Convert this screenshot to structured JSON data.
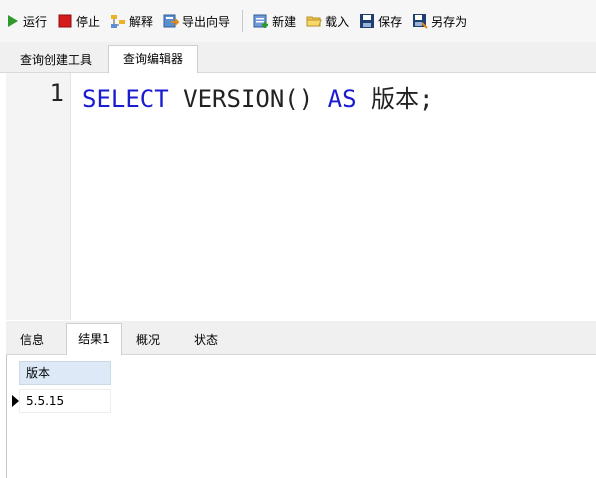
{
  "toolbar": {
    "run": "运行",
    "stop": "停止",
    "explain": "解释",
    "export_wizard": "导出向导",
    "new": "新建",
    "load": "载入",
    "save": "保存",
    "save_as": "另存为"
  },
  "top_tabs": [
    "查询创建工具",
    "查询编辑器"
  ],
  "editor": {
    "line_number": "1",
    "keyword_select": "SELECT",
    "function": "VERSION()",
    "keyword_as": "AS",
    "alias": "版本;"
  },
  "bottom_tabs": [
    "信息",
    "结果1",
    "概况",
    "状态"
  ],
  "results": {
    "column": "版本",
    "value": "5.5.15"
  },
  "colors": {
    "keyword": "#1a1ad0",
    "run_green": "#2e9a2e",
    "stop_red": "#d61b1b",
    "header_blue": "#dde9f6"
  }
}
